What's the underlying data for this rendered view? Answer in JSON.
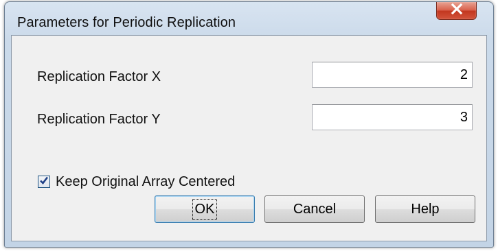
{
  "window": {
    "title": "Parameters for Periodic Replication"
  },
  "fields": {
    "replication_x": {
      "label": "Replication Factor X",
      "value": "2"
    },
    "replication_y": {
      "label": "Replication Factor Y",
      "value": "3"
    }
  },
  "options": {
    "keep_centered": {
      "label": "Keep Original Array Centered",
      "checked": true
    }
  },
  "buttons": {
    "ok": "OK",
    "cancel": "Cancel",
    "help": "Help"
  },
  "icons": {
    "close": "close-icon",
    "checkbox": "checkmark-icon"
  },
  "colors": {
    "close_button": "#c8432c",
    "checkmark": "#1d3f86",
    "frame": "#c9d9eb",
    "client": "#f0f0f0"
  }
}
